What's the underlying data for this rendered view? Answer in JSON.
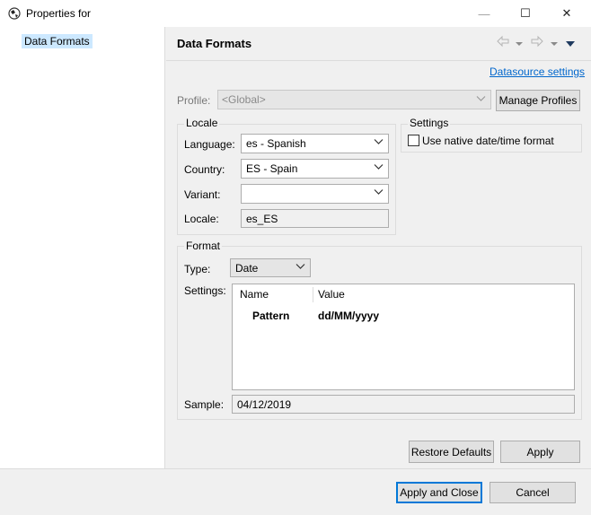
{
  "window": {
    "title": "Properties for",
    "minimize_glyph": "—",
    "maximize_glyph": "☐",
    "close_glyph": "✕"
  },
  "tree": {
    "items": [
      {
        "label": "Data Formats",
        "selected": true
      }
    ]
  },
  "page": {
    "title": "Data Formats",
    "datasource_link": "Datasource settings"
  },
  "profile": {
    "label": "Profile:",
    "value": "<Global>",
    "manage_button": "Manage Profiles"
  },
  "locale": {
    "group_title": "Locale",
    "language_label": "Language:",
    "language_value": "es - Spanish",
    "country_label": "Country:",
    "country_value": "ES - Spain",
    "variant_label": "Variant:",
    "variant_value": "",
    "locale_label": "Locale:",
    "locale_value": "es_ES"
  },
  "settings": {
    "group_title": "Settings",
    "native_label": "Use native date/time format",
    "native_checked": false
  },
  "format": {
    "group_title": "Format",
    "type_label": "Type:",
    "type_value": "Date",
    "settings_label": "Settings:",
    "columns": [
      "Name",
      "Value"
    ],
    "rows": [
      {
        "name": "Pattern",
        "value": "dd/MM/yyyy"
      }
    ],
    "sample_label": "Sample:",
    "sample_value": "04/12/2019"
  },
  "buttons": {
    "restore_defaults": "Restore Defaults",
    "apply": "Apply",
    "apply_and_close": "Apply and Close",
    "cancel": "Cancel"
  },
  "colors": {
    "selection": "#cce8ff",
    "link": "#0066cc",
    "panel": "#f0f0f0",
    "default_button_border": "#0078d7"
  }
}
